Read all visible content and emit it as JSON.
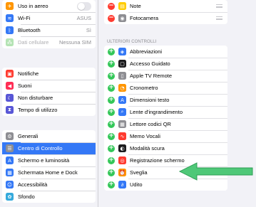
{
  "sidebar": {
    "group1": [
      {
        "label": "Uso in aereo",
        "icon": "airplane-icon",
        "color": "#ff9500",
        "glyph": "✈",
        "toggle": "off"
      },
      {
        "label": "Wi-Fi",
        "icon": "wifi-icon",
        "color": "#3478f6",
        "glyph": "≋",
        "value": "ASUS"
      },
      {
        "label": "Bluetooth",
        "icon": "bluetooth-icon",
        "color": "#3478f6",
        "glyph": "ᛒ",
        "value": "Sì"
      },
      {
        "label": "Dati cellulare",
        "icon": "cellular-icon",
        "color": "#b4e3b4",
        "glyph": "⁂",
        "value": "Nessuna SIM",
        "disabled": true
      }
    ],
    "group2": [
      {
        "label": "Notifiche",
        "icon": "notifications-icon",
        "color": "#ff3b30",
        "glyph": "▣"
      },
      {
        "label": "Suoni",
        "icon": "sounds-icon",
        "color": "#ff2d55",
        "glyph": "◀"
      },
      {
        "label": "Non disturbare",
        "icon": "moon-icon",
        "color": "#5856d6",
        "glyph": "☾"
      },
      {
        "label": "Tempo di utilizzo",
        "icon": "hourglass-icon",
        "color": "#5856d6",
        "glyph": "⧗"
      }
    ],
    "group3": [
      {
        "label": "Generali",
        "icon": "gear-icon",
        "color": "#8e8e93",
        "glyph": "⚙"
      },
      {
        "label": "Centro di Controllo",
        "icon": "control-center-icon",
        "color": "#8e8e93",
        "glyph": "☰",
        "active": true
      },
      {
        "label": "Schermo e luminosità",
        "icon": "display-icon",
        "color": "#3478f6",
        "glyph": "A"
      },
      {
        "label": "Schermata Home e Dock",
        "icon": "home-screen-icon",
        "color": "#3478f6",
        "glyph": "▦"
      },
      {
        "label": "Accessibilità",
        "icon": "accessibility-icon",
        "color": "#3478f6",
        "glyph": "☺"
      },
      {
        "label": "Sfondo",
        "icon": "wallpaper-icon",
        "color": "#35aadc",
        "glyph": "✿"
      }
    ]
  },
  "main": {
    "included": [
      {
        "label": "Note",
        "icon": "notes-icon",
        "color": "#ffcc00",
        "glyph": "▤"
      },
      {
        "label": "Fotocamera",
        "icon": "camera-icon",
        "color": "#8e8e93",
        "glyph": "◉"
      }
    ],
    "more_header": "ULTERIORI CONTROLLI",
    "more": [
      {
        "label": "Abbreviazioni",
        "icon": "shortcuts-icon",
        "color": "#3478f6",
        "glyph": "◈"
      },
      {
        "label": "Accesso Guidato",
        "icon": "guided-access-icon",
        "color": "#1c1c1e",
        "glyph": "▢"
      },
      {
        "label": "Apple TV Remote",
        "icon": "tv-remote-icon",
        "color": "#8e8e93",
        "glyph": "▯"
      },
      {
        "label": "Cronometro",
        "icon": "stopwatch-icon",
        "color": "#ff9500",
        "glyph": "◔"
      },
      {
        "label": "Dimensioni testo",
        "icon": "text-size-icon",
        "color": "#3478f6",
        "glyph": "A"
      },
      {
        "label": "Lente d'ingrandimento",
        "icon": "magnifier-icon",
        "color": "#3478f6",
        "glyph": "⌕"
      },
      {
        "label": "Lettore codici QR",
        "icon": "qr-code-icon",
        "color": "#8e8e93",
        "glyph": "▦"
      },
      {
        "label": "Memo Vocali",
        "icon": "voice-memos-icon",
        "color": "#ff3b30",
        "glyph": "∿"
      },
      {
        "label": "Modalità scura",
        "icon": "dark-mode-icon",
        "color": "#1c1c1e",
        "glyph": "◐"
      },
      {
        "label": "Registrazione schermo",
        "icon": "screen-recording-icon",
        "color": "#ff3b30",
        "glyph": "◎"
      },
      {
        "label": "Sveglia",
        "icon": "alarm-icon",
        "color": "#ff9500",
        "glyph": "⏰"
      },
      {
        "label": "Udito",
        "icon": "hearing-icon",
        "color": "#3478f6",
        "glyph": "∂"
      }
    ]
  },
  "colors": {
    "accent": "#3478f6",
    "add": "#34c759",
    "remove": "#ff3b30",
    "arrow": "#4fc878"
  }
}
